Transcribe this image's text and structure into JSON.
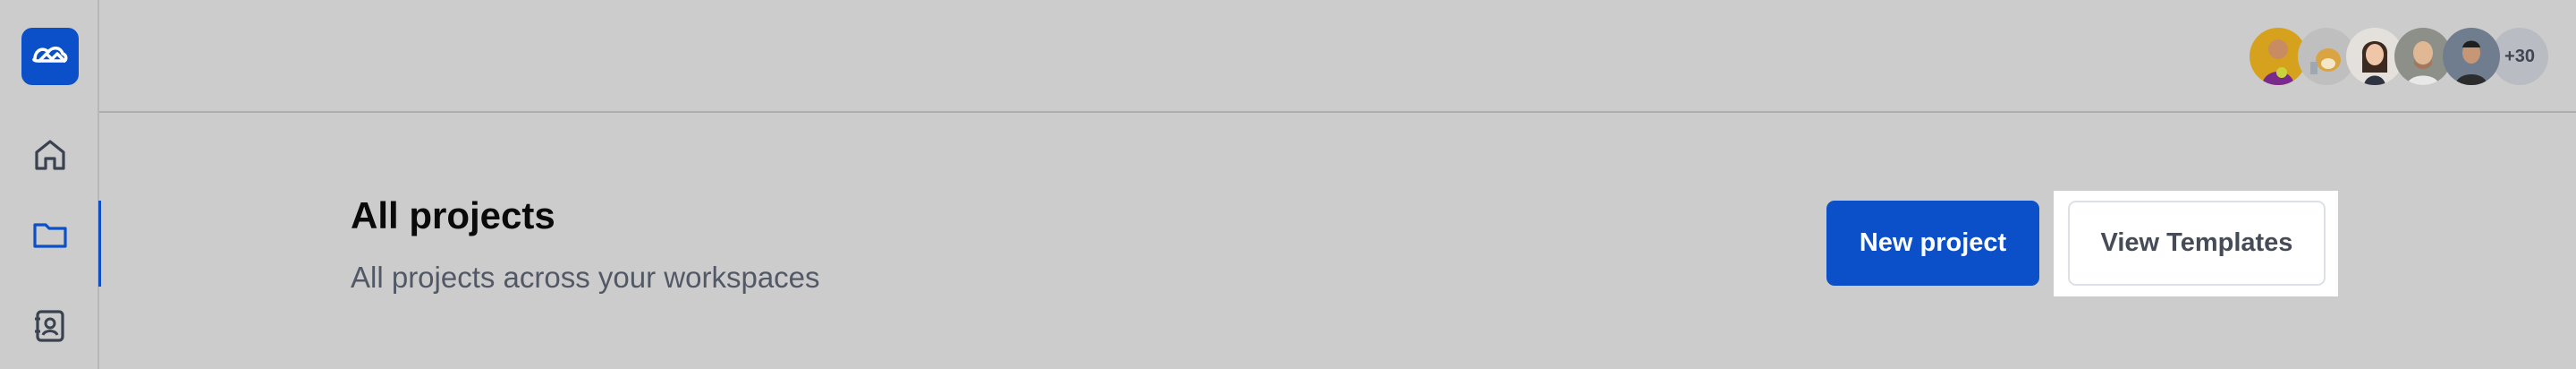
{
  "brand": {
    "logo_icon": "cloud-logo-icon",
    "accent_color": "#0b50c8"
  },
  "sidebar": {
    "items": [
      {
        "icon": "home-icon",
        "active": false
      },
      {
        "icon": "folder-icon",
        "active": true
      },
      {
        "icon": "contacts-icon",
        "active": false
      }
    ]
  },
  "header": {
    "avatars": [
      {
        "label": "user-avatar-1",
        "color": "#d6a21e"
      },
      {
        "label": "user-avatar-2",
        "color": "#c7b27a"
      },
      {
        "label": "user-avatar-3",
        "color": "#e9e3da"
      },
      {
        "label": "user-avatar-4",
        "color": "#8b8f86"
      },
      {
        "label": "user-avatar-5",
        "color": "#6f7d8e"
      }
    ],
    "more_count": "+30"
  },
  "main": {
    "title": "All projects",
    "subtitle": "All projects across your workspaces",
    "new_project_label": "New project",
    "view_templates_label": "View Templates"
  }
}
